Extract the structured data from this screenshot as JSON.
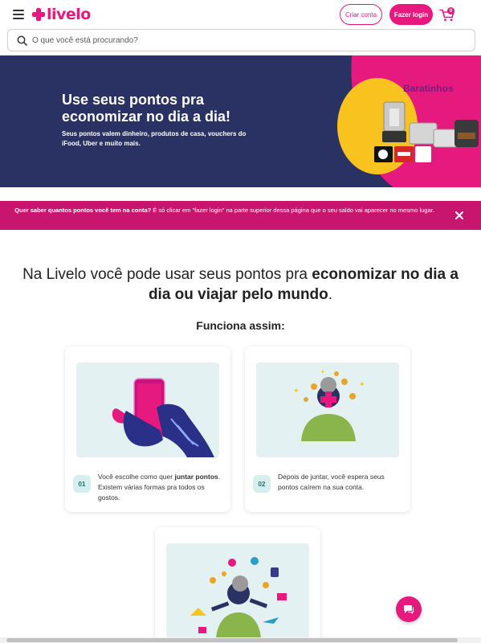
{
  "header": {
    "logo_text": "livelo",
    "create_account_label": "Criar conta",
    "login_label": "Fazer login",
    "cart_count": "0"
  },
  "search": {
    "placeholder": "O que você está procurando?"
  },
  "banner": {
    "title": "Use seus pontos pra economizar no dia a dia!",
    "subtitle": "Seus pontos valem dinheiro, produtos de casa, vouchers do iFood, Uber e muito mais.",
    "promo_name": "Baratinhos"
  },
  "notice": {
    "bold_text": "Quer saber quantos pontos você tem na conta?",
    "text": " É só clicar em \"fazer login\" na parte superior dessa página que o seu saldo vai aparecer no mesmo lugar."
  },
  "intro": {
    "text_before": "Na Livelo você pode usar seus pontos pra ",
    "text_bold": "economizar no dia a dia ou viajar pelo mundo",
    "text_after": "."
  },
  "how_it_works": "Funciona assim:",
  "steps": [
    {
      "number": "01",
      "before": "Você escolhe como quer ",
      "bold": "juntar pontos",
      "after": ". Existem várias formas pra todos os gostos."
    },
    {
      "number": "02",
      "text": "Depois de juntar, você espera seus pontos caírem na sua conta."
    }
  ],
  "colors": {
    "brand": "#e6197f",
    "banner_bg": "#2a3163",
    "notice_bg": "#c8166f"
  }
}
